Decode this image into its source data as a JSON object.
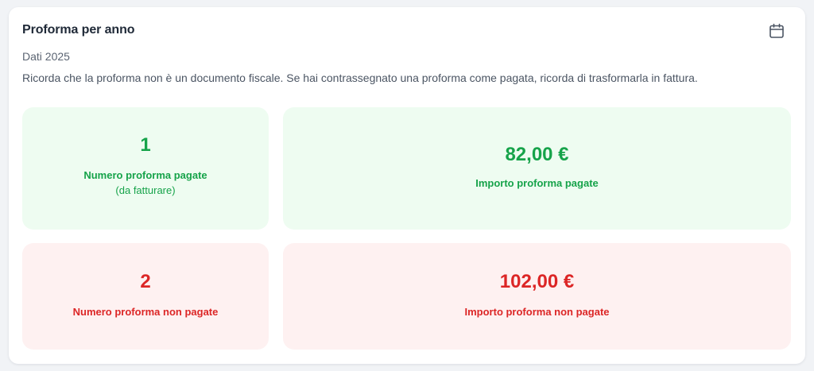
{
  "card": {
    "title": "Proforma per anno",
    "year_label": "Dati 2025",
    "note": "Ricorda che la proforma non è un documento fiscale. Se hai contrassegnato una proforma come pagata, ricorda di trasformarla in fattura.",
    "calendar_icon": "calendar-icon"
  },
  "stats": {
    "paid_count": {
      "value": "1",
      "label": "Numero proforma pagate",
      "sublabel": "(da fatturare)"
    },
    "paid_amount": {
      "value": "82,00 €",
      "label": "Importo proforma pagate"
    },
    "unpaid_count": {
      "value": "2",
      "label": "Numero proforma non pagate"
    },
    "unpaid_amount": {
      "value": "102,00 €",
      "label": "Importo proforma non pagate"
    }
  },
  "colors": {
    "paid_text": "#16a34a",
    "paid_bg": "#eefcf1",
    "unpaid_text": "#dc2626",
    "unpaid_bg": "#fef1f1"
  }
}
